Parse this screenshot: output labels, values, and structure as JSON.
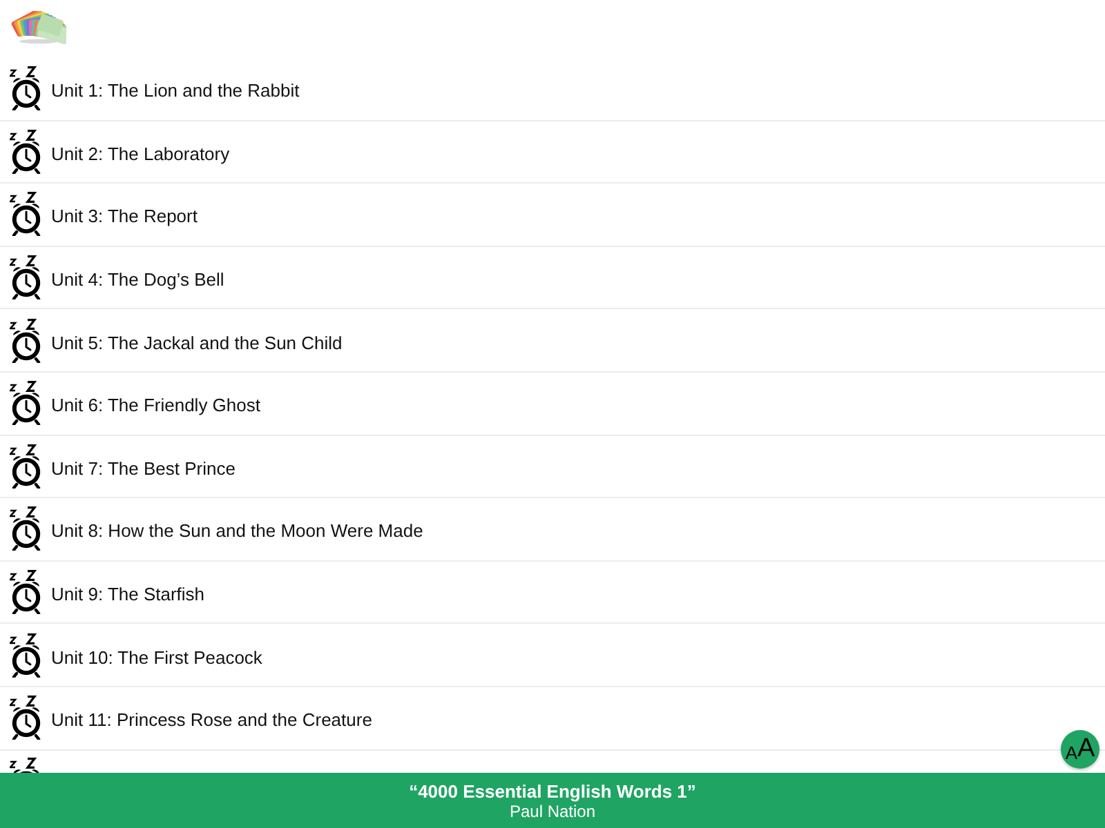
{
  "units": [
    {
      "kind": "unit",
      "title": "Unit 1: The Lion and the Rabbit"
    },
    {
      "kind": "unit",
      "title": "Unit 2: The Laboratory"
    },
    {
      "kind": "unit",
      "title": "Unit 3: The Report"
    },
    {
      "kind": "unit",
      "title": "Unit 4: The Dog’s Bell"
    },
    {
      "kind": "unit",
      "title": "Unit 5: The Jackal and the Sun Child"
    },
    {
      "kind": "unit",
      "title": "Unit 6: The Friendly Ghost"
    },
    {
      "kind": "unit",
      "title": "Unit 7: The Best Prince"
    },
    {
      "kind": "unit",
      "title": "Unit 8: How the Sun and the Moon Were Made"
    },
    {
      "kind": "unit",
      "title": "Unit 9: The Starfish"
    },
    {
      "kind": "unit",
      "title": "Unit 10: The First Peacock"
    },
    {
      "kind": "unit",
      "title": "Unit 11: Princess Rose and the Creature"
    },
    {
      "kind": "partial"
    }
  ],
  "font_button": {
    "letters": [
      "A",
      "A"
    ]
  },
  "footer": {
    "title": "“4000 Essential English Words 1”",
    "author": "Paul Nation"
  }
}
